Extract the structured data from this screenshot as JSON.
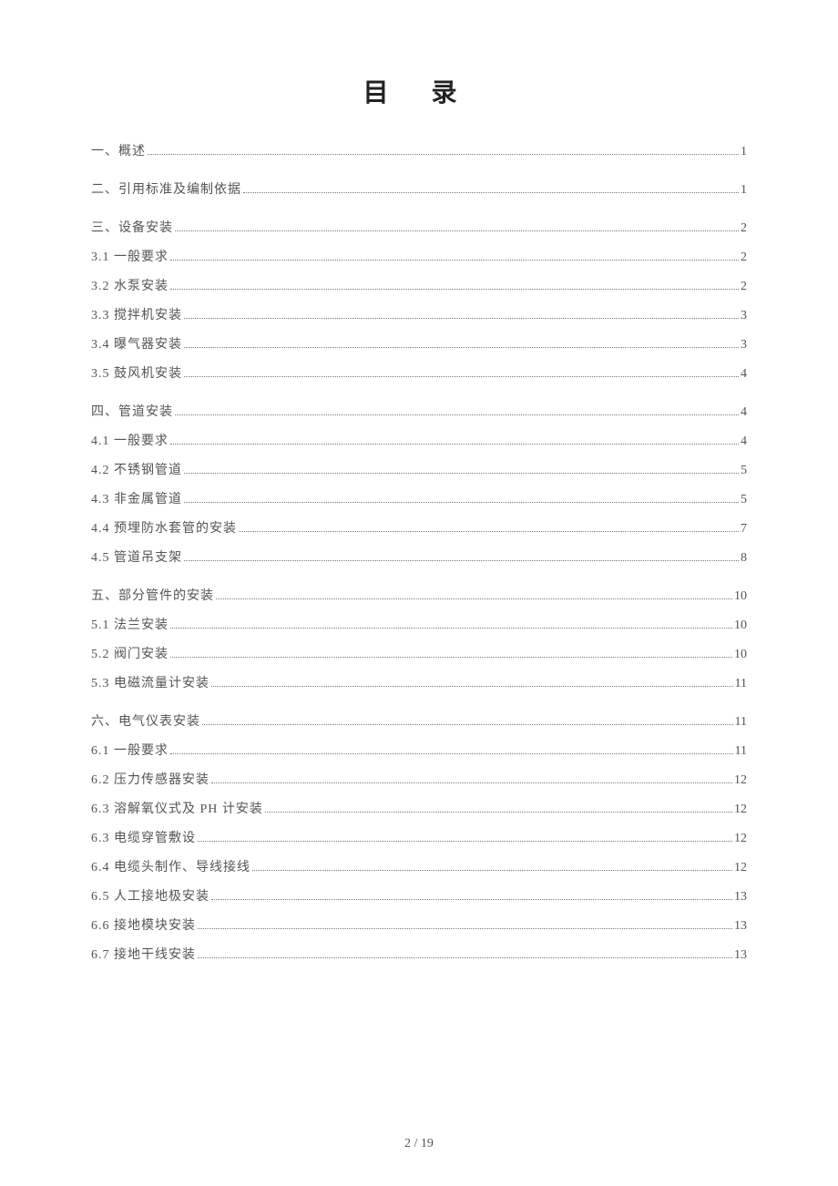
{
  "title": "目  录",
  "footer": "2 / 19",
  "toc": [
    {
      "level": 1,
      "label": "一、概述",
      "page": "1"
    },
    {
      "level": 1,
      "label": "二、引用标准及编制依据",
      "page": "1"
    },
    {
      "level": 1,
      "label": "三、设备安装",
      "page": "2"
    },
    {
      "level": 2,
      "label": "3.1 一般要求",
      "page": "2"
    },
    {
      "level": 2,
      "label": "3.2 水泵安装",
      "page": "2"
    },
    {
      "level": 2,
      "label": "3.3 搅拌机安装",
      "page": "3"
    },
    {
      "level": 2,
      "label": "3.4 曝气器安装",
      "page": "3"
    },
    {
      "level": 2,
      "label": "3.5 鼓风机安装",
      "page": "4"
    },
    {
      "level": 1,
      "label": "四、管道安装",
      "page": "4"
    },
    {
      "level": 2,
      "label": "4.1 一般要求",
      "page": "4"
    },
    {
      "level": 2,
      "label": "4.2 不锈钢管道",
      "page": "5"
    },
    {
      "level": 2,
      "label": "4.3 非金属管道",
      "page": "5"
    },
    {
      "level": 2,
      "label": "4.4 预埋防水套管的安装",
      "page": "7"
    },
    {
      "level": 2,
      "label": "4.5 管道吊支架",
      "page": "8"
    },
    {
      "level": 1,
      "label": "五、部分管件的安装",
      "page": "10"
    },
    {
      "level": 2,
      "label": "5.1 法兰安装",
      "page": "10"
    },
    {
      "level": 2,
      "label": "5.2 阀门安装",
      "page": "10"
    },
    {
      "level": 2,
      "label": "5.3 电磁流量计安装",
      "page": "11"
    },
    {
      "level": 1,
      "label": "六、电气仪表安装",
      "page": "11"
    },
    {
      "level": 2,
      "label": "6.1 一般要求",
      "page": "11"
    },
    {
      "level": 2,
      "label": "6.2 压力传感器安装",
      "page": "12"
    },
    {
      "level": 2,
      "label": "6.3 溶解氧仪式及 PH 计安装",
      "page": "12"
    },
    {
      "level": 2,
      "label": "6.3 电缆穿管敷设",
      "page": "12"
    },
    {
      "level": 2,
      "label": "6.4 电缆头制作、导线接线",
      "page": "12"
    },
    {
      "level": 2,
      "label": "6.5 人工接地极安装",
      "page": "13"
    },
    {
      "level": 2,
      "label": "6.6 接地模块安装",
      "page": "13"
    },
    {
      "level": 2,
      "label": "6.7 接地干线安装",
      "page": "13"
    }
  ]
}
